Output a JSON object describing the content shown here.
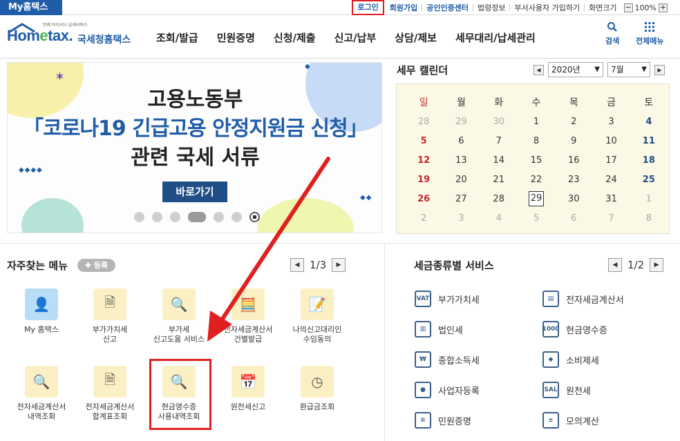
{
  "topbar": {
    "myhome": "My홈택스",
    "links": [
      "로그인",
      "회원가입",
      "공인인증센터",
      "법령정보",
      "부서사용자 가입하기",
      "화면크기"
    ],
    "zoom_minus": "−",
    "zoom_value": "100%",
    "zoom_plus": "+"
  },
  "header": {
    "logo_small": "언제 어디서나 납세서비스",
    "logo_main_a": "Hom",
    "logo_main_e": "e",
    "logo_main_b": "tax.",
    "logo_kr": "국세청홈택스",
    "nav": [
      "조회/발급",
      "민원증명",
      "신청/제출",
      "신고/납부",
      "상담/제보",
      "세무대리/납세관리"
    ],
    "search_label": "검색",
    "allmenu_label": "전체메뉴"
  },
  "banner": {
    "line1": "고용노동부",
    "line2": "「코로나19 긴급고용 안정지원금 신청」",
    "line3": "관련 국세 서류",
    "button": "바로가기"
  },
  "calendar": {
    "title": "세무 캘린더",
    "year": "2020년",
    "month": "7월",
    "weekdays": [
      "일",
      "월",
      "화",
      "수",
      "목",
      "금",
      "토"
    ],
    "weeks": [
      [
        "28",
        "29",
        "30",
        "1",
        "2",
        "3",
        "4"
      ],
      [
        "5",
        "6",
        "7",
        "8",
        "9",
        "10",
        "11"
      ],
      [
        "12",
        "13",
        "14",
        "15",
        "16",
        "17",
        "18"
      ],
      [
        "19",
        "20",
        "21",
        "22",
        "23",
        "24",
        "25"
      ],
      [
        "26",
        "27",
        "28",
        "29",
        "30",
        "31",
        "1"
      ],
      [
        "2",
        "3",
        "4",
        "5",
        "6",
        "7",
        "8"
      ]
    ],
    "today": "29"
  },
  "frequent": {
    "title": "자주찾는 메뉴",
    "register": "등록",
    "page": "1/3",
    "items": [
      {
        "line1": "My 홈택스",
        "line2": ""
      },
      {
        "line1": "부가가치세",
        "line2": "신고"
      },
      {
        "line1": "부가세",
        "line2": "신고도움 서비스"
      },
      {
        "line1": "전자세금계산서",
        "line2": "건별발급"
      },
      {
        "line1": "나의신고대리인",
        "line2": "수임동의"
      },
      {
        "line1": "전자세금계산서",
        "line2": "내역조회"
      },
      {
        "line1": "전자세금계산서",
        "line2": "합계표조회"
      },
      {
        "line1": "현금영수증",
        "line2": "사용내역조회"
      },
      {
        "line1": "원천세신고",
        "line2": ""
      },
      {
        "line1": "환급금조회",
        "line2": ""
      }
    ]
  },
  "taxservice": {
    "title": "세금종류별 서비스",
    "page": "1/2",
    "items": [
      "부가가치세",
      "전자세금계산서",
      "법인세",
      "현금영수증",
      "종합소득세",
      "소비제세",
      "사업자등록",
      "원천세",
      "민원증명",
      "모의계산"
    ]
  },
  "colors": {
    "brand": "#1f5da8",
    "highlight": "#e02020",
    "calendar_bg": "#fcf8e6",
    "icon_bg": "#fbf0c4"
  }
}
